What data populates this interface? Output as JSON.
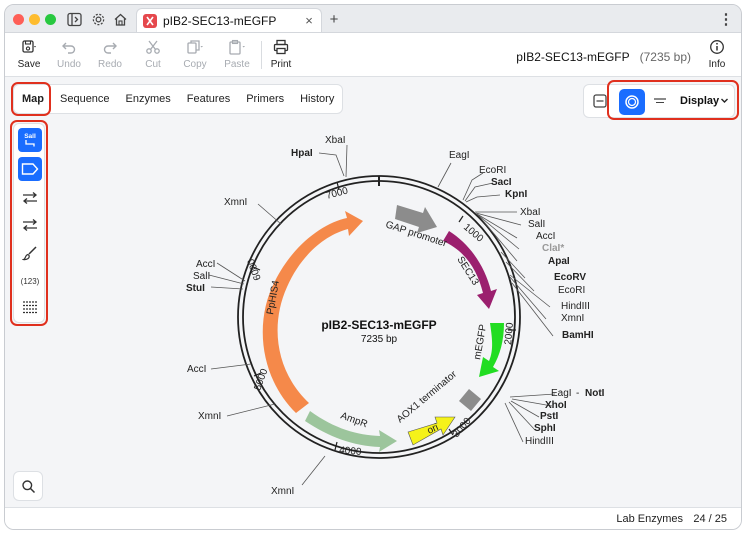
{
  "document": {
    "tab_title": "pIB2-SEC13-mEGFP",
    "tab_close": "×",
    "new_tab": "+",
    "menu": "⋮",
    "name": "pIB2-SEC13-mEGFP",
    "length": "(7235 bp)"
  },
  "toolbar": {
    "save": "Save",
    "undo": "Undo",
    "redo": "Redo",
    "cut": "Cut",
    "copy": "Copy",
    "paste": "Paste",
    "print": "Print",
    "info": "Info"
  },
  "view_tabs": [
    "Map",
    "Sequence",
    "Enzymes",
    "Features",
    "Primers",
    "History"
  ],
  "display": {
    "label": "Display"
  },
  "left_tools": {
    "enzymes_icon_text": "SalI",
    "numbers_text": "(123)"
  },
  "map": {
    "title": "pIB2-SEC13-mEGFP",
    "subtitle": "7235 bp",
    "ticks": [
      "1000",
      "2000",
      "3000",
      "4000",
      "5000",
      "6000",
      "7000"
    ],
    "features": [
      "GAP promoter",
      "SEC13",
      "mEGFP",
      "AOX1 terminator",
      "ori",
      "AmpR",
      "PpHIS4"
    ],
    "enzymes": {
      "top": [
        "HpaI",
        "XbaI",
        "EagI",
        "EcoRI",
        "SacI",
        "KpnI",
        "XbaI",
        "SalI",
        "AccI",
        "ClaI*",
        "ApaI",
        "EcoRV",
        "EcoRI",
        "HindIII",
        "XmnI",
        "BamHI"
      ],
      "lower_right": [
        "EagI",
        "NotI",
        "XhoI",
        "PstI",
        "SphI",
        "HindIII"
      ],
      "left": [
        "XmnI",
        "AccI",
        "SalI",
        "StuI",
        "AccI",
        "XmnI",
        "XmnI"
      ],
      "dash": "-"
    }
  },
  "status": {
    "enzyme_set": "Lab Enzymes",
    "count": "24 / 25"
  },
  "colors": {
    "highlight": "#e0301e",
    "accent": "#1a6dff",
    "gap_promoter": "#8c8c8c",
    "sec13": "#9b1f6e",
    "megfp": "#22dd22",
    "aox1": "#8c8c8c",
    "ori": "#f5f21a",
    "ampr": "#9cc59c",
    "phis4": "#f5894a"
  }
}
